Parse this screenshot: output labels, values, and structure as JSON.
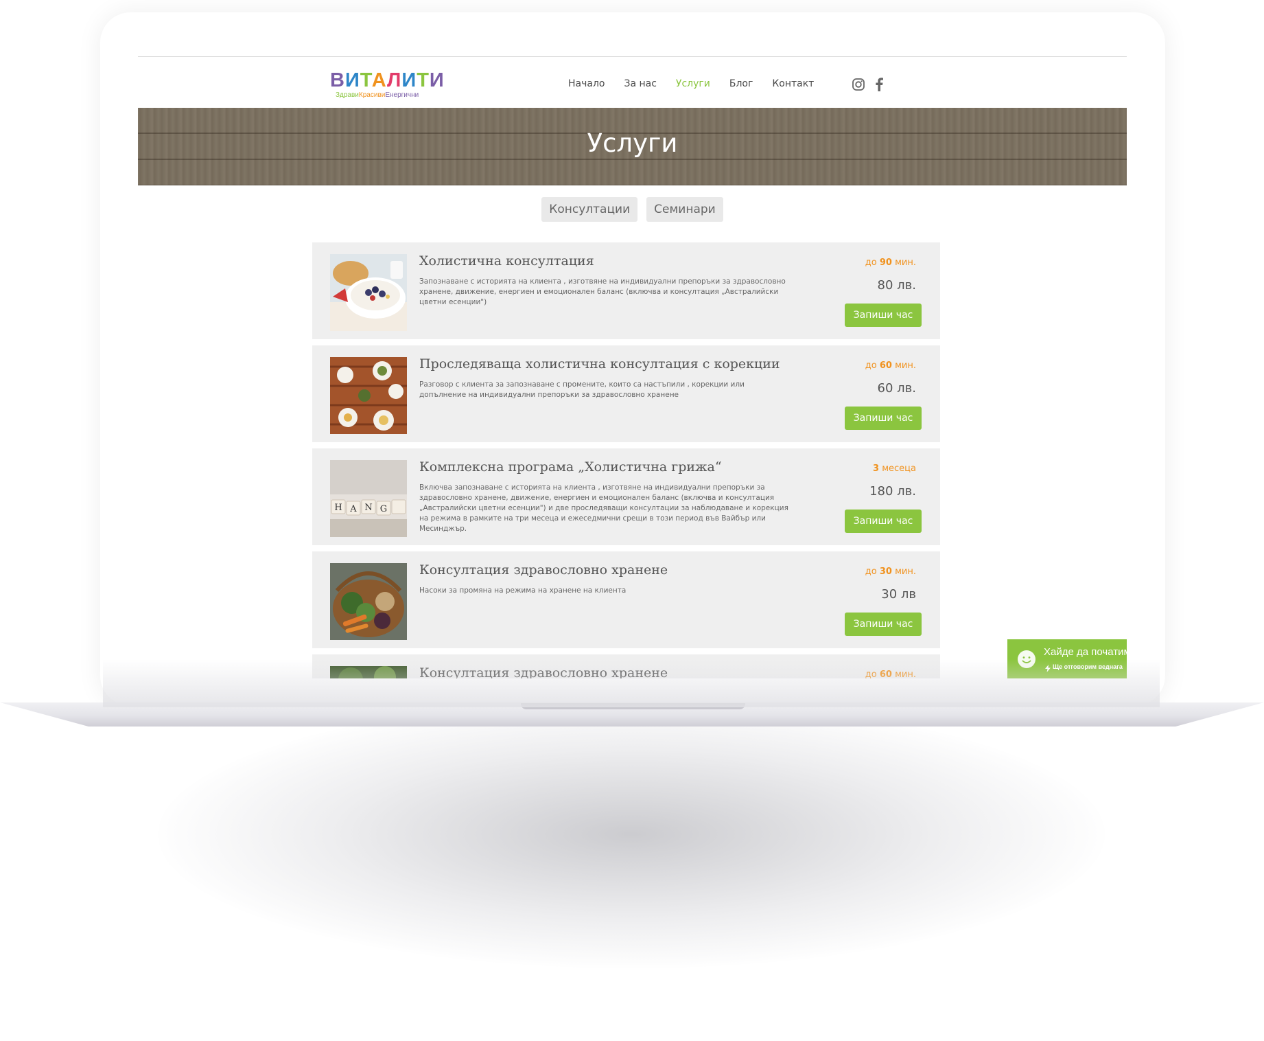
{
  "brand": {
    "letters": [
      "В",
      "И",
      "Т",
      "А",
      "Л",
      "И",
      "Т",
      "И"
    ],
    "letter_colors": [
      "#7b5ea7",
      "#2e86c8",
      "#8bc53f",
      "#f0921e",
      "#e23b6a",
      "#2e86c8",
      "#8bc53f",
      "#7b5ea7"
    ],
    "tagline": [
      "Здрави",
      "Красиви",
      "Енергични"
    ],
    "tagline_colors": [
      "#8bc53f",
      "#f0921e",
      "#7b5ea7"
    ]
  },
  "nav": {
    "items": [
      "Начало",
      "За нас",
      "Услуги",
      "Блог",
      "Контакт"
    ],
    "active": "Услуги"
  },
  "socials": [
    "instagram-icon",
    "facebook-icon"
  ],
  "hero": {
    "title": "Услуги"
  },
  "tabs": [
    "Консултации",
    "Семинари"
  ],
  "services": [
    {
      "title": "Холистична консултация",
      "description": "Запознаване с историята на клиента , изготвяне на индивидуални препоръки за здравословно хранене, движение, енергиен и емоционален баланс (включва и консултация „Австралийски цветни есенции\")",
      "duration_prefix": "до",
      "duration_value": "90",
      "duration_unit": "мин.",
      "price": "80 лв.",
      "button": "Запиши час",
      "image": "breakfast-photo"
    },
    {
      "title": "Проследяваща холистична консултация с корекции",
      "description": "Разговор с клиента за запознаване с промените, които са настъпили , корекции или допълнение на индивидуални препоръки за здравословно хранене",
      "duration_prefix": "до",
      "duration_value": "60",
      "duration_unit": "мин.",
      "price": "60 лв.",
      "button": "Запиши час",
      "image": "table-dishes-photo"
    },
    {
      "title": "Комплексна програма „Холистична грижа“",
      "description": "Включва запознаване с историята на клиента , изготвяне на индивидуални препоръки за здравословно хранене, движение, енергиен и емоционален баланс (включва и консултация „Австралийски цветни есенции\") и две проследяващи консултации за наблюдаване и корекция на режима в рамките на три месеца и ежеседмични срещи в този период във Вайбър или Месинджър.",
      "duration_prefix": "",
      "duration_value": "3",
      "duration_unit": "месеца",
      "price": "180 лв.",
      "button": "Запиши час",
      "image": "change-blocks-photo"
    },
    {
      "title": "Консултация здравословно хранене",
      "description": "Насоки за промяна на режима на хранене на клиента",
      "duration_prefix": "до",
      "duration_value": "30",
      "duration_unit": "мин.",
      "price": "30 лв",
      "button": "Запиши час",
      "image": "vegetable-basket-photo"
    },
    {
      "title": "Консултация здравословно хранене",
      "description": "",
      "duration_prefix": "до",
      "duration_value": "60",
      "duration_unit": "мин.",
      "price": "",
      "button": "",
      "image": "greens-photo"
    }
  ],
  "chat": {
    "title": "Хайде да початим",
    "subtitle": "Ще отговорим веднага",
    "icon": "smiley-icon"
  },
  "colors": {
    "accent_green": "#8bc53f",
    "accent_orange": "#f0921e",
    "card_bg": "#efefef"
  }
}
